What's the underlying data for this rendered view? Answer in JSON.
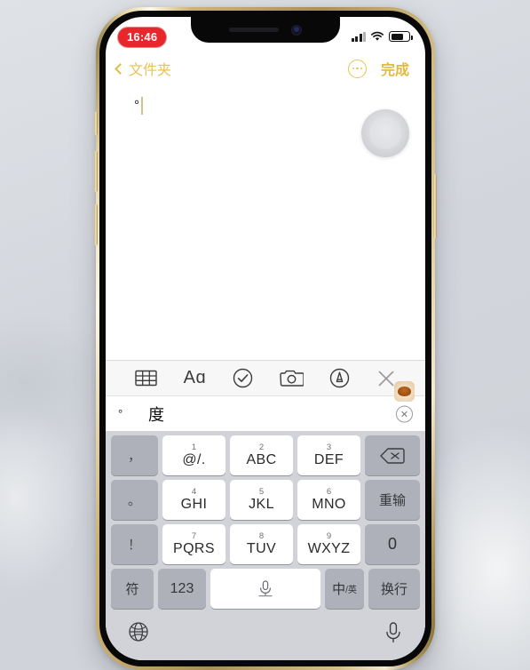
{
  "device": {
    "frame": "iphone-gold",
    "accent_gold": "#e7c353",
    "keyboard_bg": "#d1d3d9"
  },
  "status_bar": {
    "time": "16:46",
    "time_style": "recording-red-pill",
    "signal_icon": "cellular-signal-icon",
    "wifi_icon": "wifi-icon",
    "battery_icon": "battery-icon",
    "battery_level": 72
  },
  "nav_bar": {
    "back_label": "文件夹",
    "back_icon": "chevron-left-icon",
    "more_icon": "ellipsis-circle-icon",
    "done_label": "完成"
  },
  "note": {
    "text": "°",
    "caret": true,
    "assistive_touch": "assistive-touch-button"
  },
  "notes_toolbar": {
    "items": [
      {
        "name": "table-icon",
        "label": "表格"
      },
      {
        "name": "format-aa-icon",
        "label": "Aa"
      },
      {
        "name": "checklist-icon",
        "label": "清单"
      },
      {
        "name": "camera-icon",
        "label": "相机"
      },
      {
        "name": "markup-pen-icon",
        "label": "标记"
      },
      {
        "name": "close-icon",
        "label": "关闭"
      }
    ]
  },
  "candidate_bar": {
    "prefix": "°",
    "candidate": "度",
    "clear_icon": "clear-circle-x-icon",
    "emoji_badge": "emoji-sticker-icon"
  },
  "keyboard": {
    "type": "chinese-9key-pinyin",
    "rows": [
      {
        "punct": "，",
        "keys": [
          {
            "sup": "1",
            "main": "@/."
          },
          {
            "sup": "2",
            "main": "ABC"
          },
          {
            "sup": "3",
            "main": "DEF"
          }
        ],
        "action": {
          "name": "backspace-key",
          "label": "⌫"
        }
      },
      {
        "punct": "。",
        "keys": [
          {
            "sup": "4",
            "main": "GHI"
          },
          {
            "sup": "5",
            "main": "JKL"
          },
          {
            "sup": "6",
            "main": "MNO"
          }
        ],
        "action": {
          "name": "reinput-key",
          "label": "重输"
        }
      },
      {
        "punct": "？",
        "keys": [
          {
            "sup": "7",
            "main": "PQRS"
          },
          {
            "sup": "8",
            "main": "TUV"
          },
          {
            "sup": "9",
            "main": "WXYZ"
          }
        ],
        "action": {
          "name": "zero-key",
          "label": "0"
        }
      }
    ],
    "punct_extra": "！",
    "bottom_row": {
      "symbol_key": "符",
      "numeric_key": "123",
      "space_key_icon": "microphone-dictation-icon",
      "lang_main": "中",
      "lang_sub": "/英",
      "return_key": "换行"
    },
    "footer": {
      "globe_icon": "globe-language-icon",
      "mic_icon": "microphone-icon"
    }
  }
}
